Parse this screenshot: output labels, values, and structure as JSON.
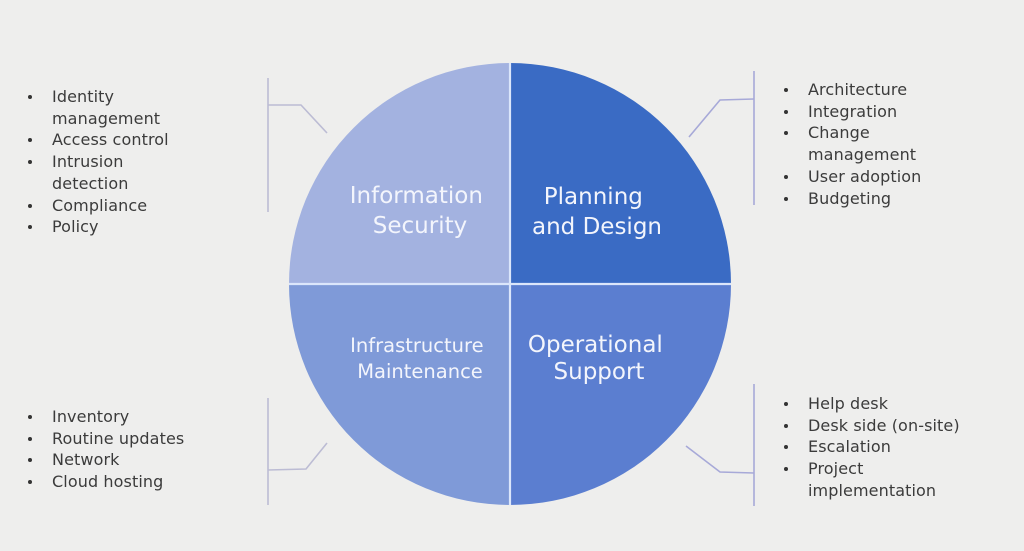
{
  "diagram": {
    "quadrants": [
      {
        "id": "top-left",
        "label_lines": [
          "Information",
          "Security"
        ],
        "color": "#a3b2e0",
        "items": [
          "Identity management",
          "Access control",
          "Intrusion detection",
          "Compliance",
          "Policy"
        ]
      },
      {
        "id": "top-right",
        "label_lines": [
          "Planning",
          "and Design"
        ],
        "color": "#3a6bc4",
        "items": [
          "Architecture",
          "Integration",
          "Change management",
          "User adoption",
          "Budgeting"
        ]
      },
      {
        "id": "bottom-left",
        "label_lines": [
          "Infrastructure",
          "Maintenance"
        ],
        "color": "#7f9ad8",
        "items": [
          "Inventory",
          "Routine updates",
          "Network",
          "Cloud hosting"
        ]
      },
      {
        "id": "bottom-right",
        "label_lines": [
          "Operational",
          "Support"
        ],
        "color": "#5b7ed0",
        "items": [
          "Help desk",
          "Desk side (on-site)",
          "Escalation",
          "Project implementation"
        ]
      }
    ],
    "colors": {
      "background": "#eeeeed",
      "divider": "#dbe6fb",
      "connector": "#bcbcd4",
      "text": "#3b3b3b"
    }
  }
}
